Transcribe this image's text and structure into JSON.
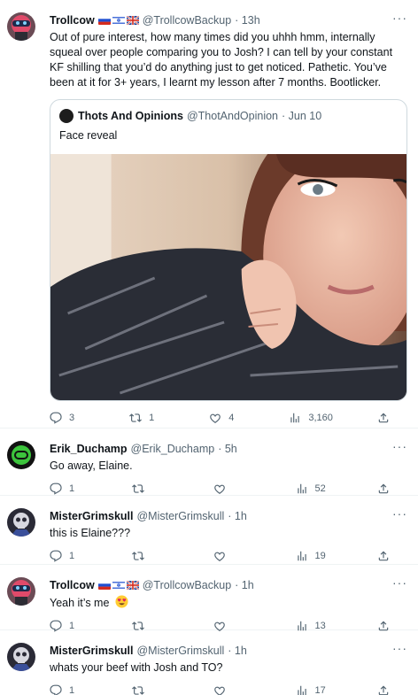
{
  "tweets": [
    {
      "name": "Trollcow",
      "handle": "@TrollcowBackup",
      "time": "· 13h",
      "text": "Out of pure interest, how many times did you uhhh hmm, internally squeal over people comparing you to Josh? I can tell by your constant KF shilling that you’d do anything just to get noticed. Pathetic. You’ve been at it for 3+ years, I learnt my lesson after 7 months. Bootlicker.",
      "quote": {
        "name": "Thots And Opinions",
        "handle": "@ThotAndOpinion",
        "time": "· Jun 10",
        "text": "Face reveal"
      },
      "stats": {
        "replies": "3",
        "retweets": "1",
        "likes": "4",
        "views": "3,160"
      }
    },
    {
      "name": "Erik_Duchamp",
      "handle": "@Erik_Duchamp",
      "time": "· 5h",
      "text": "Go away, Elaine.",
      "stats": {
        "replies": "1",
        "retweets": "",
        "likes": "",
        "views": "52"
      }
    },
    {
      "name": "MisterGrimskull",
      "handle": "@MisterGrimskull",
      "time": "· 1h",
      "text": "this is Elaine???",
      "stats": {
        "replies": "1",
        "retweets": "",
        "likes": "",
        "views": "19"
      }
    },
    {
      "name": "Trollcow",
      "handle": "@TrollcowBackup",
      "time": "· 1h",
      "text": "Yeah it’s me",
      "stats": {
        "replies": "1",
        "retweets": "",
        "likes": "",
        "views": "13"
      }
    },
    {
      "name": "MisterGrimskull",
      "handle": "@MisterGrimskull",
      "time": "· 1h",
      "text": "whats your beef with Josh and TO?",
      "stats": {
        "replies": "1",
        "retweets": "",
        "likes": "",
        "views": "17"
      }
    }
  ],
  "more_glyph": "···",
  "icons": {
    "reply": "reply-icon",
    "retweet": "retweet-icon",
    "like": "heart-icon",
    "views": "views-icon",
    "share": "share-icon"
  },
  "colors": {
    "text": "#0f1419",
    "secondary": "#536471",
    "border": "#eff3f4"
  }
}
